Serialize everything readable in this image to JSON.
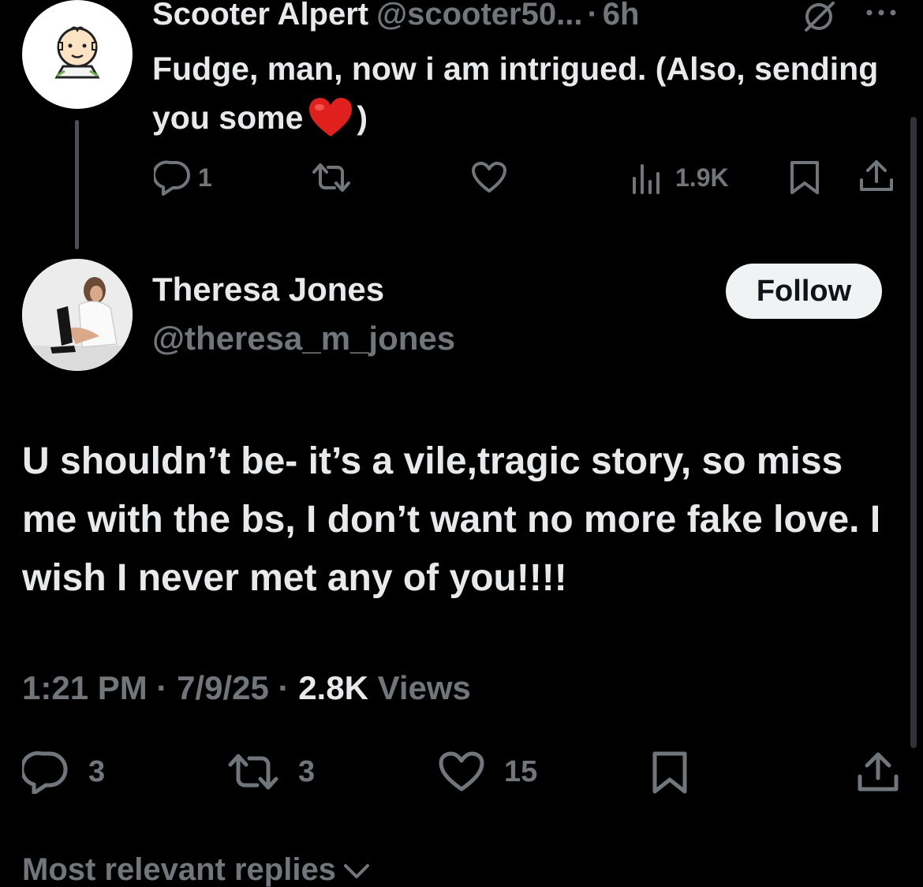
{
  "parent_tweet": {
    "author_name": "Scooter Alpert",
    "handle": "@scooter50...",
    "separator": "·",
    "time": "6h",
    "text_before_emoji": "Fudge, man, now i am intrigued.  (Also, sending you some",
    "text_after_emoji": ")",
    "emoji": "red-heart-emoji",
    "actions": {
      "replies": "1",
      "reposts": "",
      "likes": "",
      "views": "1.9K"
    },
    "icons": [
      "grok-icon",
      "more-icon",
      "reply-icon",
      "repost-icon",
      "like-icon",
      "views-icon",
      "bookmark-icon",
      "share-icon"
    ]
  },
  "main_tweet": {
    "author_name": "Theresa Jones",
    "handle": "@theresa_m_jones",
    "follow_label": "Follow",
    "text": "U shouldn’t be- it’s a vile,tragic story, so miss me with the bs, I don’t want no more fake love. I wish I never met any of you!!!!",
    "time": "1:21 PM",
    "date": "7/9/25",
    "sep": "·",
    "views_count": "2.8K",
    "views_label": "Views",
    "actions": {
      "replies": "3",
      "reposts": "3",
      "likes": "15"
    }
  },
  "replies_sort": {
    "label": "Most relevant replies",
    "icon": "chevron-down-icon"
  },
  "colors": {
    "background": "#000000",
    "primary_text": "#e7e9ea",
    "secondary_text": "#71767b",
    "button_bg": "#eff3f4",
    "heart_emoji": "#e0201c"
  }
}
